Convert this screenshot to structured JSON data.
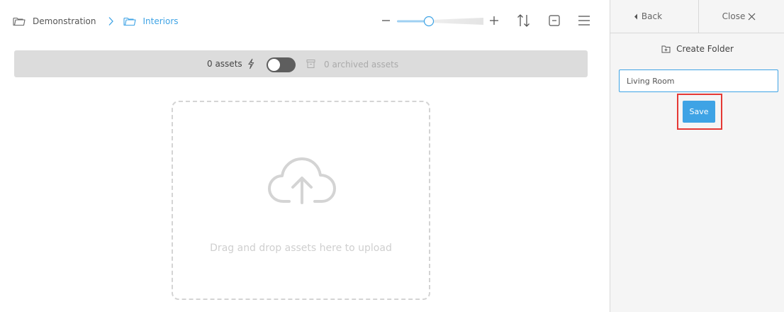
{
  "breadcrumb": {
    "items": [
      {
        "label": "Demonstration",
        "icon": "folder-icon"
      },
      {
        "label": "Interiors",
        "icon": "folder-open-icon"
      }
    ],
    "separator_icon": "chevron-right-icon"
  },
  "toolbar": {
    "zoom_level": 0.35,
    "icons": [
      "minus-icon",
      "plus-icon",
      "sort-icon",
      "collapse-icon",
      "menu-icon"
    ]
  },
  "info_bar": {
    "assets_count": "0 assets",
    "archived_count": "0 archived assets",
    "show_archived_toggle": false
  },
  "dropzone": {
    "text": "Drag and drop assets here to upload",
    "icon": "cloud-upload-icon"
  },
  "panel": {
    "back_label": "Back",
    "close_label": "Close",
    "title": "Create Folder",
    "folder_name_value": "Living Room",
    "save_label": "Save"
  },
  "colors": {
    "accent": "#3ea3e5",
    "info_bar_bg": "#dcdcdc",
    "toggle_bg": "#5e5e5e",
    "panel_bg": "#f5f5f5",
    "highlight": "#e53935"
  }
}
